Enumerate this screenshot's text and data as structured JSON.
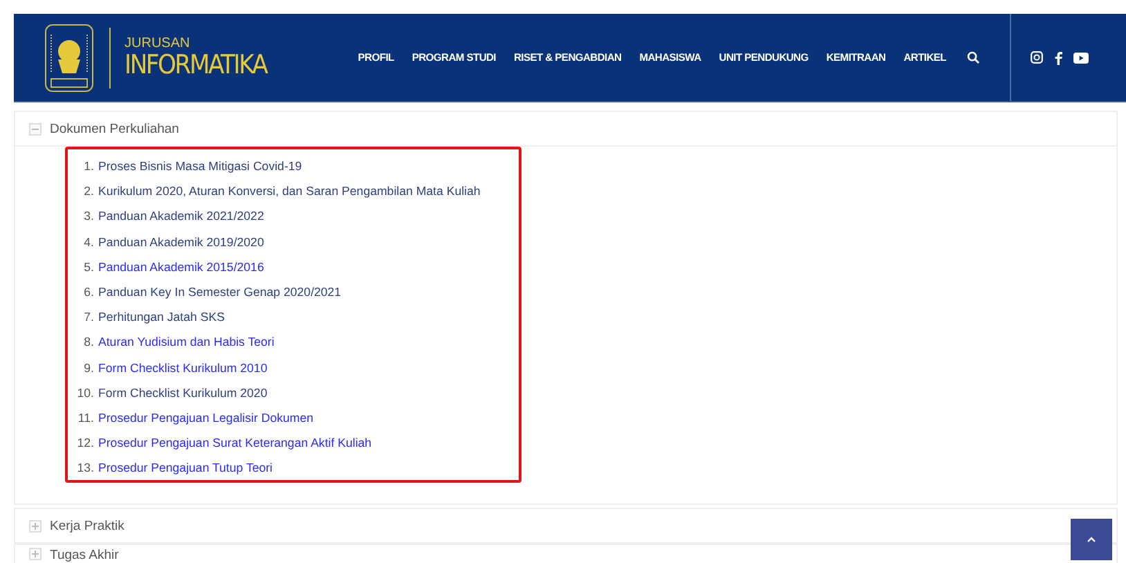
{
  "header": {
    "brand_top": "JURUSAN",
    "brand_bottom": "INFORMATIKA",
    "nav": [
      "PROFIL",
      "PROGRAM STUDI",
      "RISET & PENGABDIAN",
      "MAHASISWA",
      "UNIT PENDUKUNG",
      "KEMITRAAN",
      "ARTIKEL"
    ]
  },
  "sections": [
    {
      "title": "Dokumen Perkuliahan",
      "expanded": true,
      "items": [
        {
          "number": "1.",
          "label": "Proses Bisnis Masa Mitigasi Covid-19",
          "visited": true
        },
        {
          "number": "2.",
          "label": "Kurikulum 2020, Aturan Konversi, dan Saran Pengambilan Mata Kuliah",
          "visited": true
        },
        {
          "number": "3.",
          "label": "Panduan Akademik 2021/2022",
          "visited": true
        },
        {
          "number": "4.",
          "label": "Panduan Akademik 2019/2020",
          "visited": true
        },
        {
          "number": "5.",
          "label": "Panduan Akademik 2015/2016",
          "visited": false
        },
        {
          "number": "6.",
          "label": "Panduan Key In Semester Genap 2020/2021",
          "visited": true
        },
        {
          "number": "7.",
          "label": "Perhitungan Jatah SKS",
          "visited": true
        },
        {
          "number": "8.",
          "label": "Aturan Yudisium dan Habis Teori",
          "visited": false
        },
        {
          "number": "9.",
          "label": "Form Checklist Kurikulum 2010",
          "visited": false
        },
        {
          "number": "10.",
          "label": "Form Checklist Kurikulum 2020",
          "visited": true
        },
        {
          "number": "11.",
          "label": "Prosedur Pengajuan Legalisir Dokumen",
          "visited": false
        },
        {
          "number": "12.",
          "label": "Prosedur Pengajuan Surat Keterangan Aktif Kuliah",
          "visited": false
        },
        {
          "number": "13.",
          "label": "Prosedur Pengajuan Tutup Teori",
          "visited": false
        }
      ]
    },
    {
      "title": "Kerja Praktik",
      "expanded": false
    },
    {
      "title": "Tugas Akhir",
      "expanded": false
    }
  ]
}
